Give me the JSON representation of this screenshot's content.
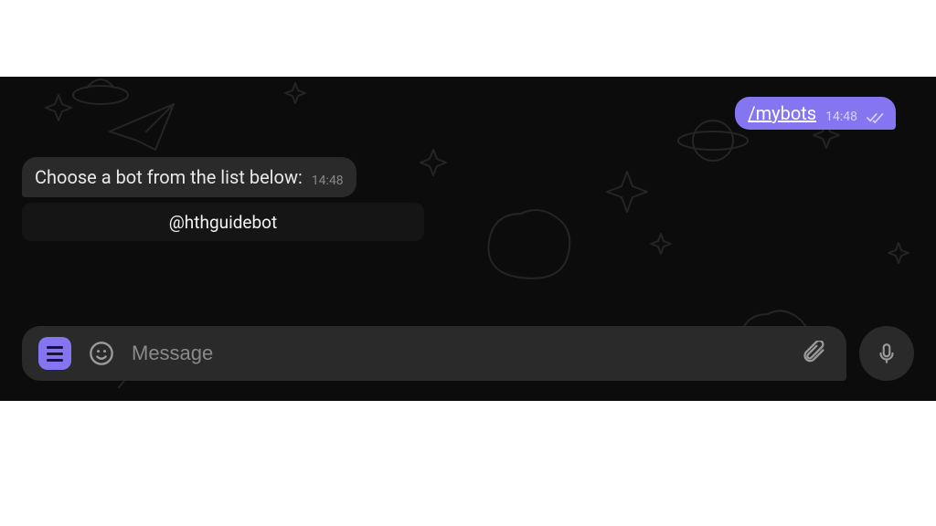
{
  "colors": {
    "accent": "#8675f0"
  },
  "sent": {
    "text": "/mybots",
    "time": "14:48"
  },
  "received": {
    "text": "Choose a bot from the list below:",
    "time": "14:48"
  },
  "keyboard": {
    "button0": "@hthguidebot"
  },
  "composer": {
    "placeholder": "Message"
  }
}
